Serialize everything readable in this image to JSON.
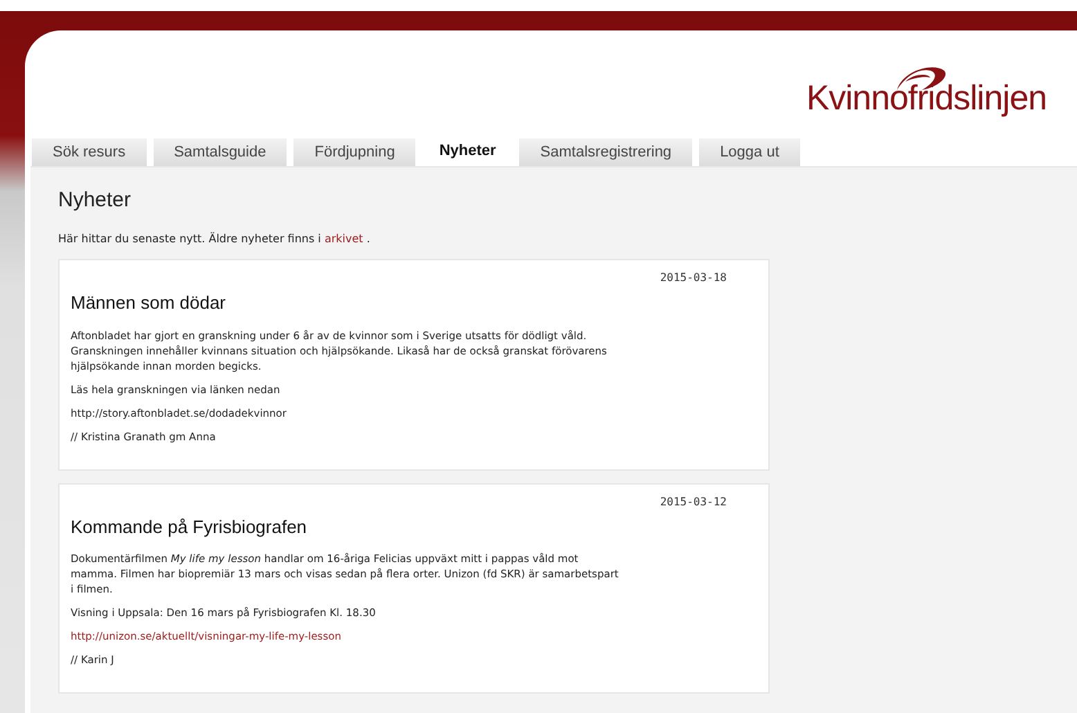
{
  "logo": {
    "text": "Kvinnofridslinjen"
  },
  "tabs": [
    {
      "label": "Sök resurs",
      "selected": false
    },
    {
      "label": "Samtalsguide",
      "selected": false
    },
    {
      "label": "Fördjupning",
      "selected": false
    },
    {
      "label": "Nyheter",
      "selected": true
    },
    {
      "label": "Samtalsregistrering",
      "selected": false
    },
    {
      "label": "Logga ut",
      "selected": false
    }
  ],
  "heading": "Nyheter",
  "intro": {
    "text": "Här hittar du senaste nytt. Äldre nyheter finns i",
    "link": "arkivet",
    "after": "."
  },
  "news": [
    {
      "date": "2015-03-18",
      "title": "Männen som dödar",
      "paragraphs": [
        {
          "kind": "text",
          "text": "Aftonbladet har gjort en granskning under 6 år av de kvinnor som i Sverige utsatts för dödligt våld. Granskningen innehåller kvinnans situation och hjälpsökande. Likaså har de också granskat förövarens hjälpsökande innan morden begicks."
        },
        {
          "kind": "text",
          "text": "Läs hela granskningen via länken nedan"
        },
        {
          "kind": "text",
          "text": "http://story.aftonbladet.se/dodadekvinnor"
        },
        {
          "kind": "text",
          "text": "// Kristina Granath gm Anna"
        }
      ]
    },
    {
      "date": "2015-03-12",
      "title": "Kommande på Fyrisbiografen",
      "paragraphs": [
        {
          "kind": "text",
          "text": "Dokumentärfilmen *My life my lesson* handlar om 16-åriga Felicias uppväxt mitt i pappas våld mot mamma. Filmen har biopremiär 13 mars och visas sedan på flera orter. Unizon (fd SKR) är samarbetspart i filmen."
        },
        {
          "kind": "text",
          "text": "Visning i Uppsala: Den 16 mars på Fyrisbiografen Kl. 18.30"
        },
        {
          "kind": "link",
          "text": "http://unizon.se/aktuellt/visningar-my-life-my-lesson"
        },
        {
          "kind": "text",
          "text": "// Karin J"
        }
      ]
    }
  ]
}
